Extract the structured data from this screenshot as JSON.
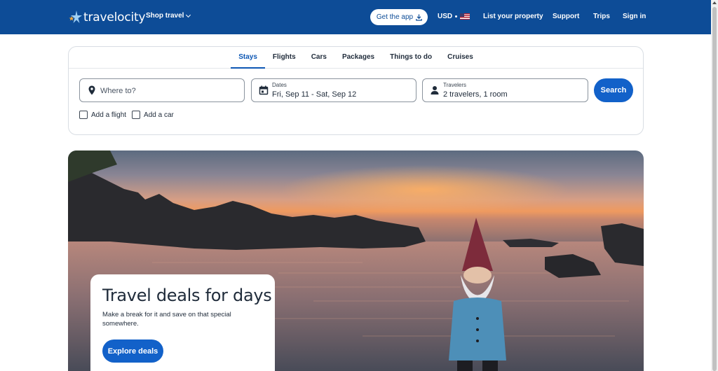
{
  "header": {
    "brand": "travelocity",
    "shop_travel": "Shop travel",
    "get_app": "Get the app",
    "currency": "USD",
    "list_property": "List your property",
    "support": "Support",
    "trips": "Trips",
    "sign_in": "Sign in",
    "bg_color": "#0d4c97"
  },
  "search": {
    "tabs": [
      {
        "label": "Stays",
        "active": true
      },
      {
        "label": "Flights",
        "active": false
      },
      {
        "label": "Cars",
        "active": false
      },
      {
        "label": "Packages",
        "active": false
      },
      {
        "label": "Things to do",
        "active": false
      },
      {
        "label": "Cruises",
        "active": false
      }
    ],
    "where_placeholder": "Where to?",
    "dates_label": "Dates",
    "dates_value": "Fri, Sep 11 - Sat, Sep 12",
    "travelers_label": "Travelers",
    "travelers_value": "2 travelers, 1 room",
    "search_button": "Search",
    "add_flight": "Add a flight",
    "add_car": "Add a car",
    "accent_color": "#1261c9"
  },
  "hero": {
    "title": "Travel deals for days",
    "subtitle": "Make a break for it and save on that special somewhere.",
    "cta": "Explore deals"
  }
}
